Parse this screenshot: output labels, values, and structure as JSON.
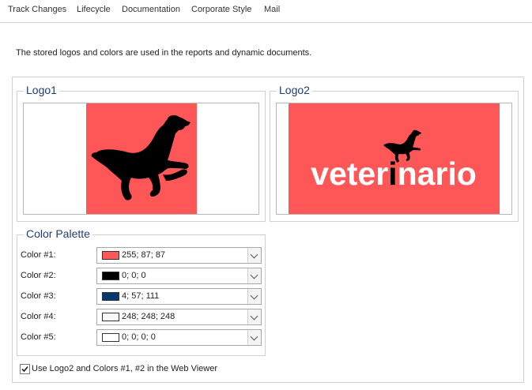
{
  "tabs": [
    {
      "label": "Track Changes"
    },
    {
      "label": "Lifecycle"
    },
    {
      "label": "Documentation"
    },
    {
      "label": "Corporate Style",
      "active": true
    },
    {
      "label": "Mail"
    }
  ],
  "description": "The stored logos and colors are used in the reports and dynamic documents.",
  "logo1": {
    "title": "Logo1",
    "image": "black-jumping-dog-on-red"
  },
  "logo2": {
    "title": "Logo2",
    "image": "veterinario-logo",
    "wordmark_light": "veter",
    "wordmark_dark": "i",
    "wordmark_light2": "nario"
  },
  "palette": {
    "title": "Color Palette",
    "colors": [
      {
        "label": "Color #1:",
        "value": "255; 87; 87",
        "hex": "#ff5757"
      },
      {
        "label": "Color #2:",
        "value": "0; 0; 0",
        "hex": "#000000"
      },
      {
        "label": "Color #3:",
        "value": "4; 57; 111",
        "hex": "#04396f"
      },
      {
        "label": "Color #4:",
        "value": "248; 248; 248",
        "hex": "#f8f8f8"
      },
      {
        "label": "Color #5:",
        "value": "0; 0; 0; 0",
        "hex": "#ffffff"
      }
    ]
  },
  "web_viewer_option": {
    "label": "Use Logo2 and Colors #1, #2 in the Web Viewer",
    "checked": true
  }
}
